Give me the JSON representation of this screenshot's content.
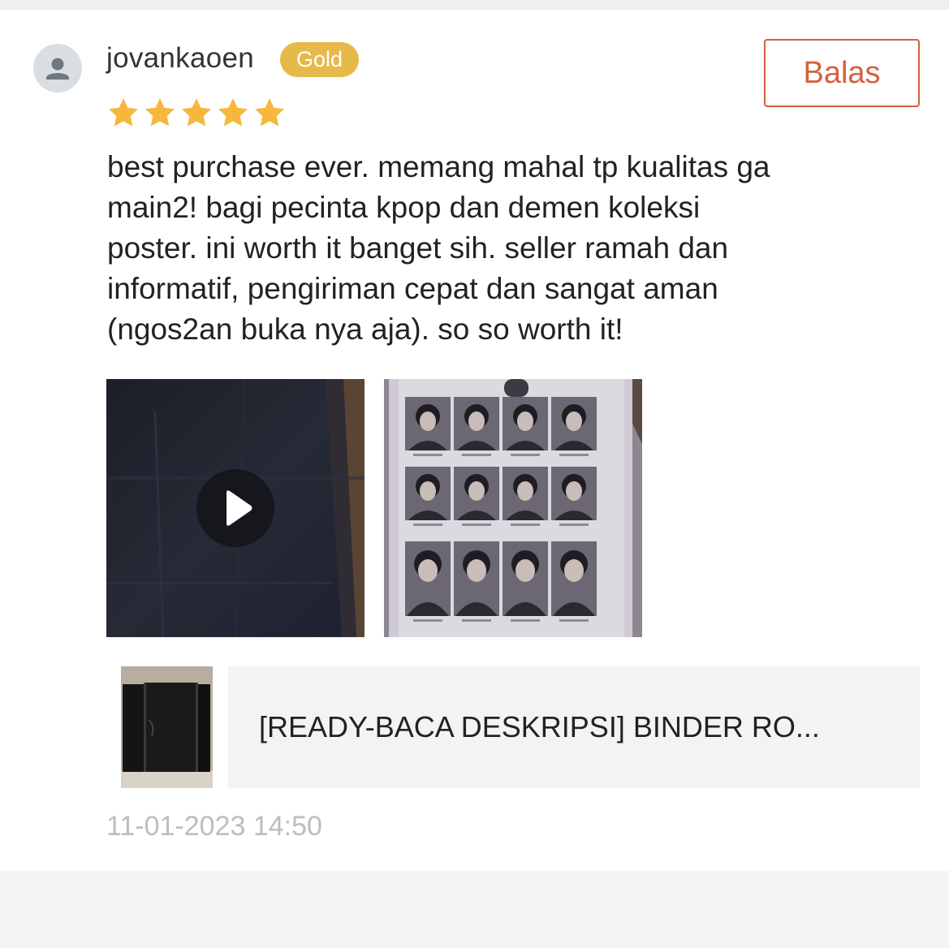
{
  "review": {
    "user": {
      "name": "jovankaoen",
      "badge": "Gold",
      "avatar_icon": "person-icon"
    },
    "reply_label": "Balas",
    "rating": 5,
    "rating_max": 5,
    "star_icon": "star-icon",
    "text_lines": [
      "best purchase ever. memang mahal tp kualitas ga",
      "main2! bagi pecinta kpop dan demen koleksi",
      "poster. ini worth it banget sih. seller ramah dan",
      "informatif, pengiriman cepat dan sangat aman",
      "(ngos2an buka nya aja). so so worth it!"
    ],
    "media": [
      {
        "type": "video",
        "icon": "play-icon"
      },
      {
        "type": "photo"
      }
    ],
    "product": {
      "title": "[READY-BACA DESKRIPSI] BINDER RO..."
    },
    "timestamp": "11-01-2023 14:50"
  },
  "colors": {
    "accent": "#d5613c",
    "badge_gold": "#e7b94a",
    "star": "#f6b73c",
    "timestamp": "#bdbdbd"
  }
}
